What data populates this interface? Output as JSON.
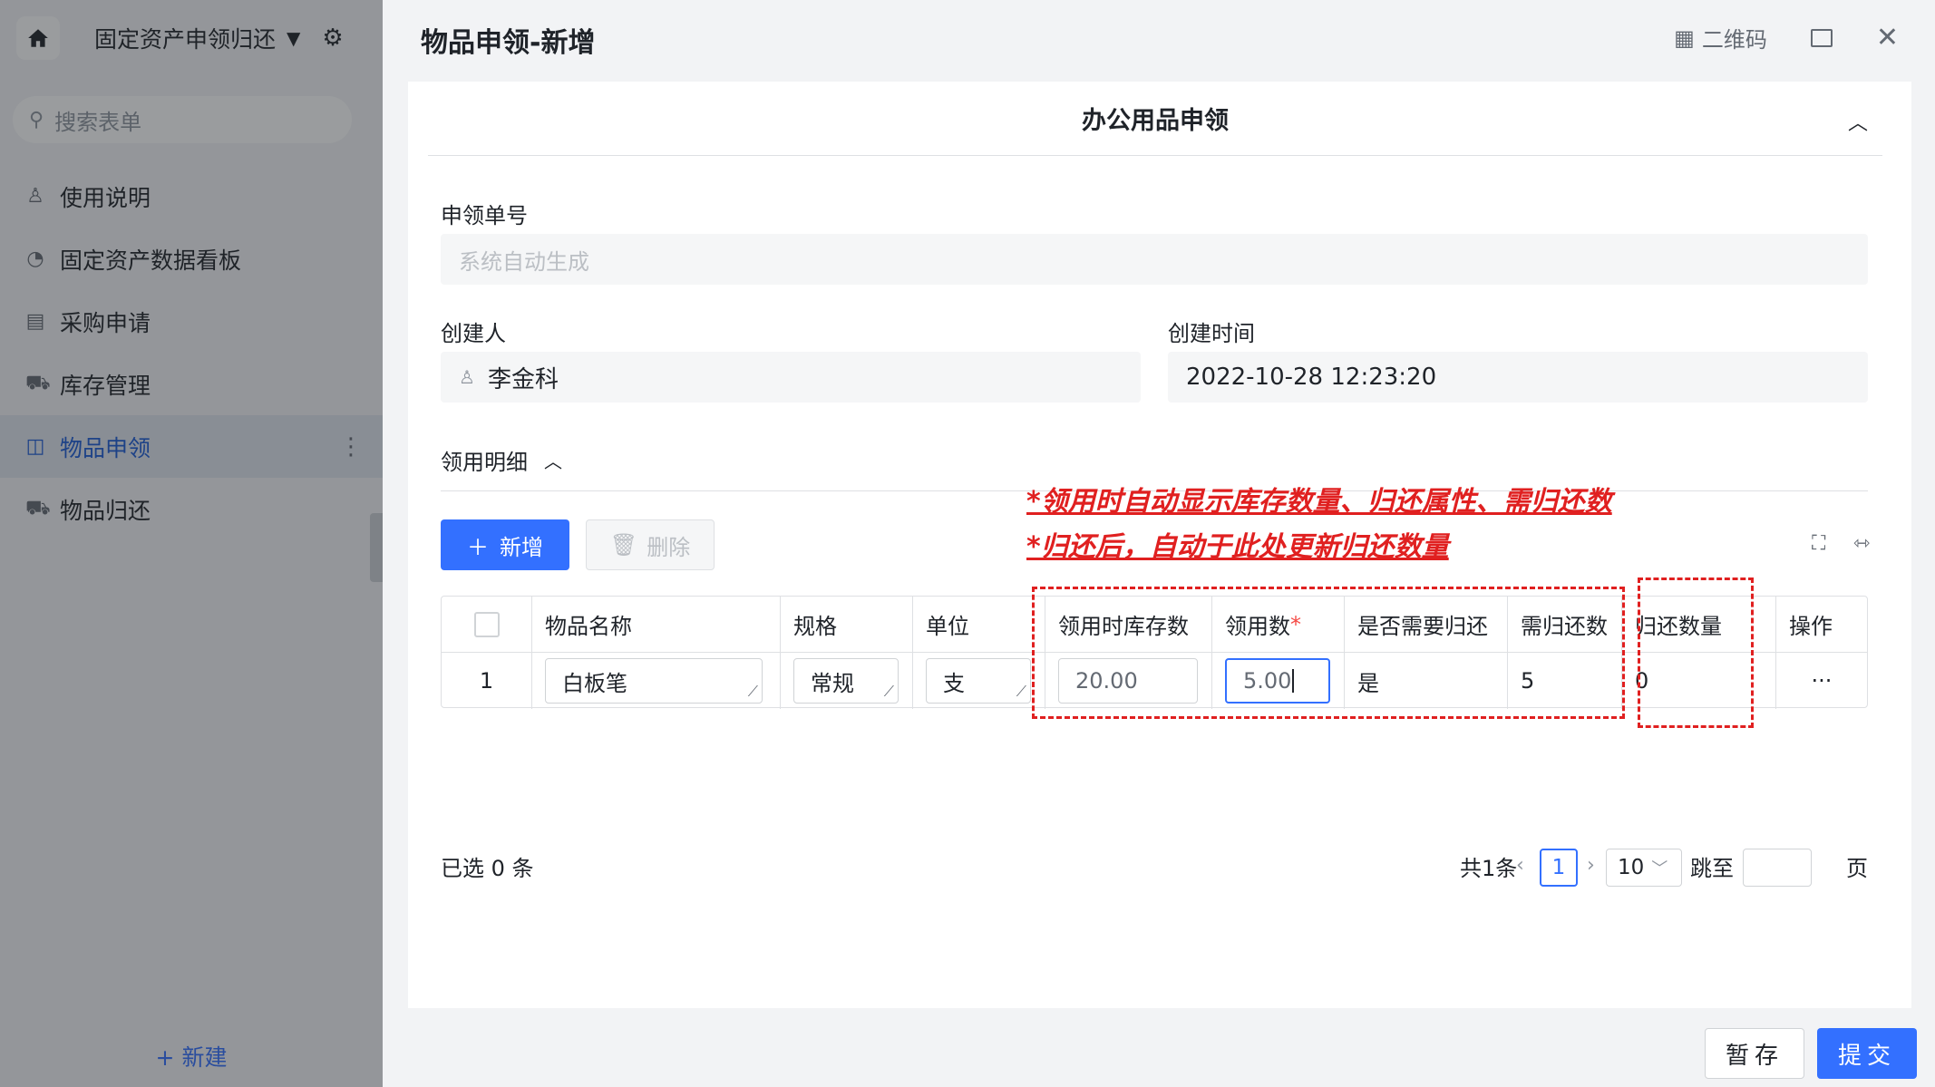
{
  "sidebar": {
    "app_title": "固定资产申领归还",
    "search_placeholder": "搜索表单",
    "items": [
      {
        "label": "使用说明"
      },
      {
        "label": "固定资产数据看板"
      },
      {
        "label": "采购申请"
      },
      {
        "label": "库存管理"
      },
      {
        "label": "物品申领"
      },
      {
        "label": "物品归还"
      }
    ],
    "new_label": "+ 新建"
  },
  "modal": {
    "title": "物品申领-新增",
    "qr_label": "二维码"
  },
  "form": {
    "section_title": "办公用品申领",
    "order_no_label": "申领单号",
    "order_no_placeholder": "系统自动生成",
    "creator_label": "创建人",
    "creator_value": "李金科",
    "created_time_label": "创建时间",
    "created_time_value": "2022-10-28 12:23:20",
    "detail_title": "领用明细",
    "add_label": "新增",
    "delete_label": "删除"
  },
  "annotations": {
    "line1": "*领用时自动显示库存数量、归还属性、需归还数",
    "line2": "*归还后，自动于此处更新归还数量"
  },
  "table": {
    "headers": {
      "name": "物品名称",
      "spec": "规格",
      "unit": "单位",
      "stock": "领用时库存数",
      "qty": "领用数",
      "qty_required_mark": "*",
      "need_return": "是否需要归还",
      "return_required": "需归还数",
      "returned": "归还数量",
      "ops": "操作"
    },
    "rows": [
      {
        "index": "1",
        "name": "白板笔",
        "spec": "常规",
        "unit": "支",
        "stock": "20.00",
        "qty": "5.00",
        "need_return": "是",
        "return_required": "5",
        "returned": "0",
        "ops": "···"
      }
    ]
  },
  "footer": {
    "selected": "已选 0 条",
    "total": "共1条",
    "current_page": "1",
    "page_size": "10",
    "jump_label": "跳至",
    "page_suffix": "页"
  },
  "actions": {
    "save": "暂存",
    "submit": "提交"
  },
  "colors": {
    "primary": "#3370ff",
    "annotation": "#e02020"
  }
}
